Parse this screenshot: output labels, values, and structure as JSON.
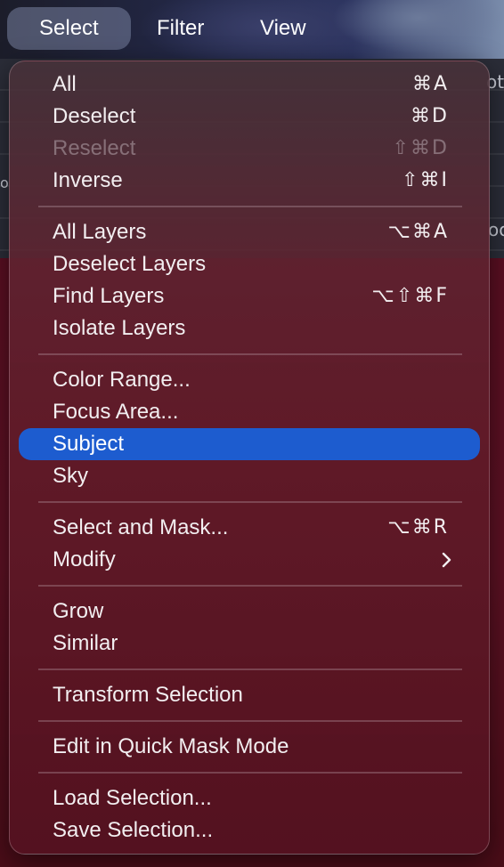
{
  "menubar": {
    "items": [
      {
        "label": "Select",
        "active": true
      },
      {
        "label": "Filter",
        "active": false
      },
      {
        "label": "View",
        "active": false
      }
    ]
  },
  "background": {
    "edge_text_1": "ot",
    "edge_text_2": "oo",
    "edge_text_3": "o"
  },
  "menu": {
    "title": "Select",
    "groups": [
      {
        "items": [
          {
            "label": "All",
            "shortcut": "⌘A",
            "enabled": true
          },
          {
            "label": "Deselect",
            "shortcut": "⌘D",
            "enabled": true
          },
          {
            "label": "Reselect",
            "shortcut": "⇧⌘D",
            "enabled": false
          },
          {
            "label": "Inverse",
            "shortcut": "⇧⌘I",
            "enabled": true
          }
        ]
      },
      {
        "items": [
          {
            "label": "All Layers",
            "shortcut": "⌥⌘A",
            "enabled": true
          },
          {
            "label": "Deselect Layers",
            "shortcut": "",
            "enabled": true
          },
          {
            "label": "Find Layers",
            "shortcut": "⌥⇧⌘F",
            "enabled": true
          },
          {
            "label": "Isolate Layers",
            "shortcut": "",
            "enabled": true
          }
        ]
      },
      {
        "items": [
          {
            "label": "Color Range...",
            "shortcut": "",
            "enabled": true
          },
          {
            "label": "Focus Area...",
            "shortcut": "",
            "enabled": true
          },
          {
            "label": "Subject",
            "shortcut": "",
            "enabled": true,
            "highlighted": true
          },
          {
            "label": "Sky",
            "shortcut": "",
            "enabled": true
          }
        ]
      },
      {
        "items": [
          {
            "label": "Select and Mask...",
            "shortcut": "⌥⌘R",
            "enabled": true
          },
          {
            "label": "Modify",
            "shortcut": "",
            "enabled": true,
            "submenu": true,
            "submenu_icon": "chevron-right-icon"
          }
        ]
      },
      {
        "items": [
          {
            "label": "Grow",
            "shortcut": "",
            "enabled": true
          },
          {
            "label": "Similar",
            "shortcut": "",
            "enabled": true
          }
        ]
      },
      {
        "items": [
          {
            "label": "Transform Selection",
            "shortcut": "",
            "enabled": true
          }
        ]
      },
      {
        "items": [
          {
            "label": "Edit in Quick Mask Mode",
            "shortcut": "",
            "enabled": true
          }
        ]
      },
      {
        "items": [
          {
            "label": "Load Selection...",
            "shortcut": "",
            "enabled": true
          },
          {
            "label": "Save Selection...",
            "shortcut": "",
            "enabled": true
          }
        ]
      }
    ],
    "colors": {
      "highlight": "#1d5ccf",
      "text": "#f2eef0",
      "disabled_text": "rgba(230,220,225,0.38)"
    }
  }
}
